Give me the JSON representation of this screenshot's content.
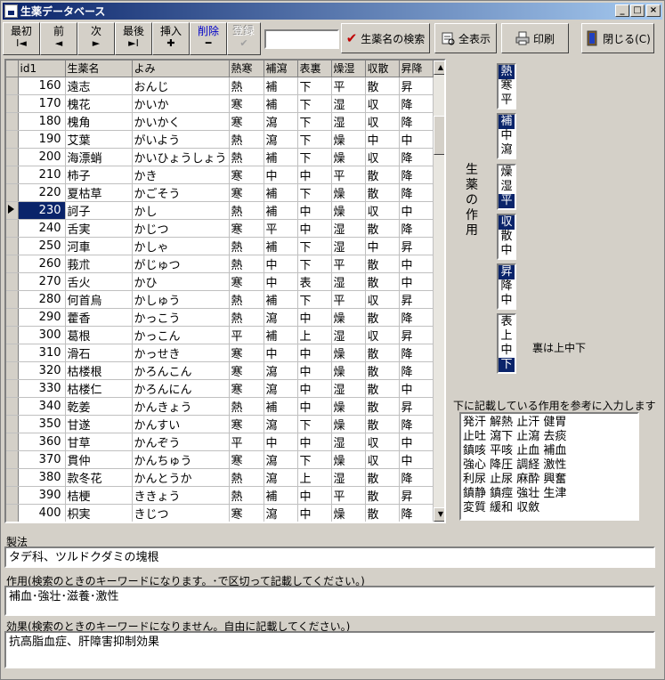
{
  "window": {
    "title": "生薬データベース",
    "controls": [
      "_",
      "□",
      "×"
    ]
  },
  "toolbar": {
    "nav": [
      {
        "label": "最初",
        "glyph": "I◄"
      },
      {
        "label": "前",
        "glyph": "◄"
      },
      {
        "label": "次",
        "glyph": "►"
      },
      {
        "label": "最後",
        "glyph": "►I"
      },
      {
        "label": "挿入",
        "glyph": "✚"
      },
      {
        "label": "削除",
        "glyph": "━"
      },
      {
        "label": "登録",
        "glyph": "✔"
      }
    ],
    "search_value": "",
    "search_button": "生薬名の検索",
    "show_all_button": "全表示",
    "print_button": "印刷",
    "close_button": "閉じる(C)"
  },
  "grid": {
    "columns": [
      "id1",
      "生薬名",
      "よみ",
      "熱寒",
      "補瀉",
      "表裏",
      "燥湿",
      "収散",
      "昇降"
    ],
    "current_row": 7,
    "rows": [
      [
        "160",
        "遠志",
        "おんじ",
        "熱",
        "補",
        "下",
        "平",
        "散",
        "昇"
      ],
      [
        "170",
        "槐花",
        "かいか",
        "寒",
        "補",
        "下",
        "湿",
        "収",
        "降"
      ],
      [
        "180",
        "槐角",
        "かいかく",
        "寒",
        "瀉",
        "下",
        "湿",
        "収",
        "降"
      ],
      [
        "190",
        "艾葉",
        "がいよう",
        "熱",
        "瀉",
        "下",
        "燥",
        "中",
        "中"
      ],
      [
        "200",
        "海漂蛸",
        "かいひょうしょう",
        "熱",
        "補",
        "下",
        "燥",
        "収",
        "降"
      ],
      [
        "210",
        "柿子",
        "かき",
        "寒",
        "中",
        "中",
        "平",
        "散",
        "降"
      ],
      [
        "220",
        "夏枯草",
        "かごそう",
        "寒",
        "補",
        "下",
        "燥",
        "散",
        "降"
      ],
      [
        "230",
        "訶子",
        "かし",
        "熱",
        "補",
        "中",
        "燥",
        "収",
        "中"
      ],
      [
        "240",
        "舌実",
        "かじつ",
        "寒",
        "平",
        "中",
        "湿",
        "散",
        "降"
      ],
      [
        "250",
        "河車",
        "かしゃ",
        "熱",
        "補",
        "下",
        "湿",
        "中",
        "昇"
      ],
      [
        "260",
        "莪朮",
        "がじゅつ",
        "熱",
        "中",
        "下",
        "平",
        "散",
        "中"
      ],
      [
        "270",
        "舌火",
        "かひ",
        "寒",
        "中",
        "表",
        "湿",
        "散",
        "中"
      ],
      [
        "280",
        "何首烏",
        "かしゅう",
        "熱",
        "補",
        "下",
        "平",
        "収",
        "昇"
      ],
      [
        "290",
        "藿香",
        "かっこう",
        "熱",
        "瀉",
        "中",
        "燥",
        "散",
        "降"
      ],
      [
        "300",
        "葛根",
        "かっこん",
        "平",
        "補",
        "上",
        "湿",
        "収",
        "昇"
      ],
      [
        "310",
        "滑石",
        "かっせき",
        "寒",
        "中",
        "中",
        "燥",
        "散",
        "降"
      ],
      [
        "320",
        "枯楼根",
        "かろんこん",
        "寒",
        "瀉",
        "中",
        "燥",
        "散",
        "降"
      ],
      [
        "330",
        "枯楼仁",
        "かろんにん",
        "寒",
        "瀉",
        "中",
        "湿",
        "散",
        "中"
      ],
      [
        "340",
        "乾姜",
        "かんきょう",
        "熱",
        "補",
        "中",
        "燥",
        "散",
        "昇"
      ],
      [
        "350",
        "甘遂",
        "かんすい",
        "寒",
        "瀉",
        "下",
        "燥",
        "散",
        "降"
      ],
      [
        "360",
        "甘草",
        "かんぞう",
        "平",
        "中",
        "中",
        "湿",
        "収",
        "中"
      ],
      [
        "370",
        "貫仲",
        "かんちゅう",
        "寒",
        "瀉",
        "下",
        "燥",
        "収",
        "中"
      ],
      [
        "380",
        "款冬花",
        "かんとうか",
        "熱",
        "瀉",
        "上",
        "湿",
        "散",
        "降"
      ],
      [
        "390",
        "桔梗",
        "ききょう",
        "熱",
        "補",
        "中",
        "平",
        "散",
        "昇"
      ],
      [
        "400",
        "枳実",
        "きじつ",
        "寒",
        "瀉",
        "中",
        "燥",
        "散",
        "降"
      ]
    ]
  },
  "effects_panel": {
    "vertical_label": "生薬の作用",
    "lists": [
      {
        "items": [
          "熱",
          "寒",
          "平"
        ],
        "selected": 0
      },
      {
        "items": [
          "補",
          "中",
          "瀉"
        ],
        "selected": 0
      },
      {
        "items": [
          "燥",
          "湿",
          "平"
        ],
        "selected": 2
      },
      {
        "items": [
          "収",
          "散",
          "中"
        ],
        "selected": 0
      },
      {
        "items": [
          "昇",
          "降",
          "中"
        ],
        "selected": 0
      },
      {
        "items": [
          "表",
          "上",
          "中",
          "下"
        ],
        "selected": 3
      }
    ],
    "note": "裏は上中下"
  },
  "reference": {
    "hint": "下に記載している作用を参考に入力します",
    "lines": [
      "発汗 解熱 止汗 健胃",
      "止吐 瀉下 止瀉 去痰",
      "鎮咳 平咳 止血 補血",
      "強心 降圧 調経 激性",
      "利尿 止尿 麻酔 興奮",
      "鎮静 鎮痙 強壮 生津",
      "変質 緩和 収斂"
    ]
  },
  "fields": {
    "seiho_label": "製法",
    "seiho_value": "タデ科、ツルドクダミの塊根",
    "sayou_label": "作用(検索のときのキーワードになります。･で区切って記載してください。)",
    "sayou_value": "補血･強壮･滋養･激性",
    "kouka_label": "効果(検索のときのキーワードになりません。自由に記載してください。)",
    "kouka_value": "抗高脂血症、肝障害抑制効果"
  }
}
